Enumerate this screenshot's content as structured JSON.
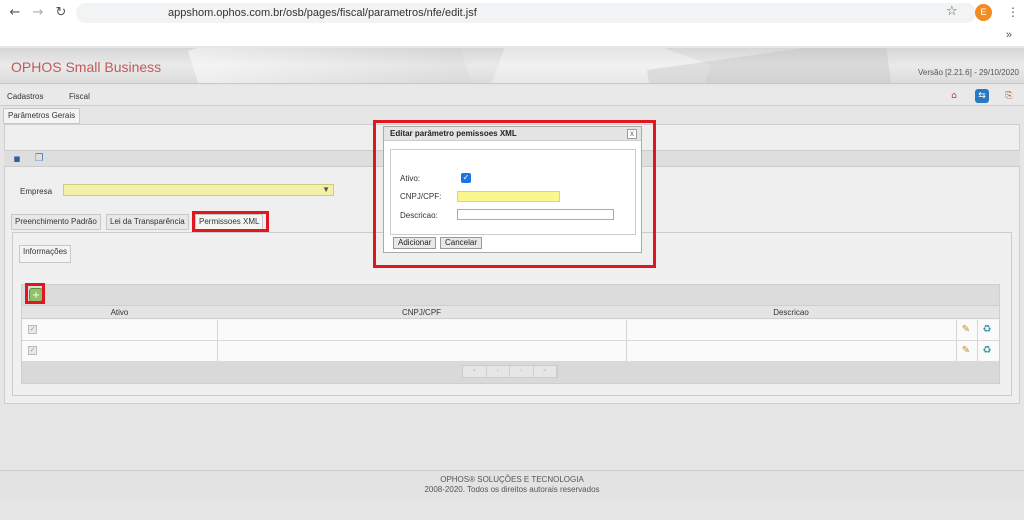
{
  "browser": {
    "back_icon": "←",
    "forward_icon": "→",
    "reload_icon": "↻",
    "url": "appshom.ophos.com.br/osb/pages/fiscal/parametros/nfe/edit.jsf",
    "star_icon": "☆",
    "profile_initial": "E",
    "menu_icon": "⋮",
    "bookmarks_more": "»"
  },
  "header": {
    "brand": "OPHOS Small Business",
    "version": "Versão [2.21.6] - 29/10/2020"
  },
  "menu": {
    "items": [
      "Cadastros",
      "Fiscal"
    ]
  },
  "page": {
    "tab_label": "Parâmetros Gerais",
    "empresa_label": "Empresa",
    "empresa_value": "",
    "subtabs": [
      "Preenchimento Padrão",
      "Lei da Transparência",
      "Permissoes XML"
    ],
    "info_tab": "Informações"
  },
  "grid": {
    "columns": [
      "Ativo",
      "CNPJ/CPF",
      "Descricao"
    ],
    "rows": [
      {
        "ativo": true,
        "cnpj": "",
        "descricao": ""
      },
      {
        "ativo": true,
        "cnpj": "",
        "descricao": ""
      }
    ],
    "pager": [
      "«",
      "‹",
      "›",
      "»"
    ]
  },
  "dialog": {
    "title": "Editar parâmetro pemissoes XML",
    "close": "x",
    "ativo_label": "Ativo:",
    "cnpj_label": "CNPJ/CPF:",
    "cnpj_value": "",
    "descricao_label": "Descricao:",
    "descricao_value": "",
    "add_button": "Adicionar",
    "cancel_button": "Cancelar"
  },
  "footer": {
    "line1": "OPHOS® SOLUÇÕES E TECNOLOGIA",
    "line2": "2008-2020. Todos os direitos autorais reservados"
  },
  "colors": {
    "highlight_red": "#e0171e",
    "brand": "#c05a5a",
    "required_field": "#f3f1a7"
  }
}
